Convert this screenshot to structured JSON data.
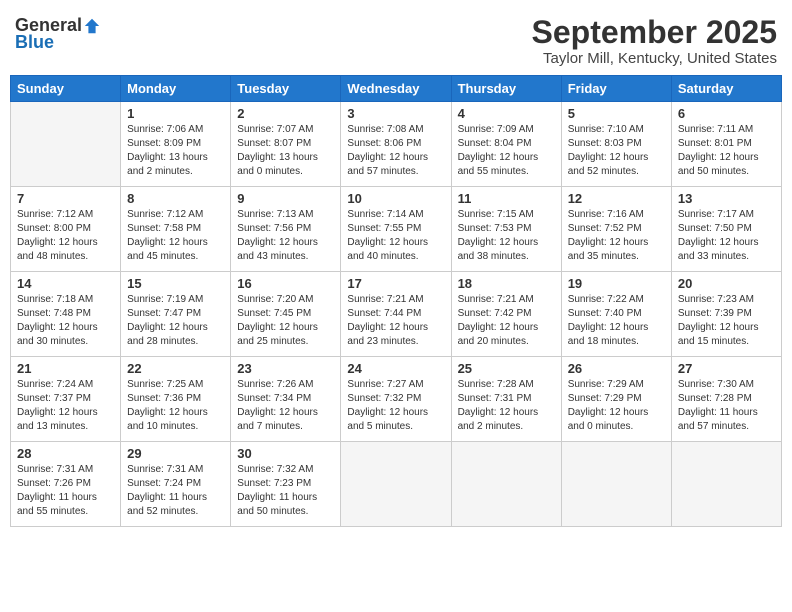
{
  "header": {
    "logo_general": "General",
    "logo_blue": "Blue",
    "month": "September 2025",
    "location": "Taylor Mill, Kentucky, United States"
  },
  "days_of_week": [
    "Sunday",
    "Monday",
    "Tuesday",
    "Wednesday",
    "Thursday",
    "Friday",
    "Saturday"
  ],
  "weeks": [
    [
      {
        "day": "",
        "sunrise": "",
        "sunset": "",
        "daylight": "",
        "empty": true
      },
      {
        "day": "1",
        "sunrise": "Sunrise: 7:06 AM",
        "sunset": "Sunset: 8:09 PM",
        "daylight": "Daylight: 13 hours and 2 minutes."
      },
      {
        "day": "2",
        "sunrise": "Sunrise: 7:07 AM",
        "sunset": "Sunset: 8:07 PM",
        "daylight": "Daylight: 13 hours and 0 minutes."
      },
      {
        "day": "3",
        "sunrise": "Sunrise: 7:08 AM",
        "sunset": "Sunset: 8:06 PM",
        "daylight": "Daylight: 12 hours and 57 minutes."
      },
      {
        "day": "4",
        "sunrise": "Sunrise: 7:09 AM",
        "sunset": "Sunset: 8:04 PM",
        "daylight": "Daylight: 12 hours and 55 minutes."
      },
      {
        "day": "5",
        "sunrise": "Sunrise: 7:10 AM",
        "sunset": "Sunset: 8:03 PM",
        "daylight": "Daylight: 12 hours and 52 minutes."
      },
      {
        "day": "6",
        "sunrise": "Sunrise: 7:11 AM",
        "sunset": "Sunset: 8:01 PM",
        "daylight": "Daylight: 12 hours and 50 minutes."
      }
    ],
    [
      {
        "day": "7",
        "sunrise": "Sunrise: 7:12 AM",
        "sunset": "Sunset: 8:00 PM",
        "daylight": "Daylight: 12 hours and 48 minutes."
      },
      {
        "day": "8",
        "sunrise": "Sunrise: 7:12 AM",
        "sunset": "Sunset: 7:58 PM",
        "daylight": "Daylight: 12 hours and 45 minutes."
      },
      {
        "day": "9",
        "sunrise": "Sunrise: 7:13 AM",
        "sunset": "Sunset: 7:56 PM",
        "daylight": "Daylight: 12 hours and 43 minutes."
      },
      {
        "day": "10",
        "sunrise": "Sunrise: 7:14 AM",
        "sunset": "Sunset: 7:55 PM",
        "daylight": "Daylight: 12 hours and 40 minutes."
      },
      {
        "day": "11",
        "sunrise": "Sunrise: 7:15 AM",
        "sunset": "Sunset: 7:53 PM",
        "daylight": "Daylight: 12 hours and 38 minutes."
      },
      {
        "day": "12",
        "sunrise": "Sunrise: 7:16 AM",
        "sunset": "Sunset: 7:52 PM",
        "daylight": "Daylight: 12 hours and 35 minutes."
      },
      {
        "day": "13",
        "sunrise": "Sunrise: 7:17 AM",
        "sunset": "Sunset: 7:50 PM",
        "daylight": "Daylight: 12 hours and 33 minutes."
      }
    ],
    [
      {
        "day": "14",
        "sunrise": "Sunrise: 7:18 AM",
        "sunset": "Sunset: 7:48 PM",
        "daylight": "Daylight: 12 hours and 30 minutes."
      },
      {
        "day": "15",
        "sunrise": "Sunrise: 7:19 AM",
        "sunset": "Sunset: 7:47 PM",
        "daylight": "Daylight: 12 hours and 28 minutes."
      },
      {
        "day": "16",
        "sunrise": "Sunrise: 7:20 AM",
        "sunset": "Sunset: 7:45 PM",
        "daylight": "Daylight: 12 hours and 25 minutes."
      },
      {
        "day": "17",
        "sunrise": "Sunrise: 7:21 AM",
        "sunset": "Sunset: 7:44 PM",
        "daylight": "Daylight: 12 hours and 23 minutes."
      },
      {
        "day": "18",
        "sunrise": "Sunrise: 7:21 AM",
        "sunset": "Sunset: 7:42 PM",
        "daylight": "Daylight: 12 hours and 20 minutes."
      },
      {
        "day": "19",
        "sunrise": "Sunrise: 7:22 AM",
        "sunset": "Sunset: 7:40 PM",
        "daylight": "Daylight: 12 hours and 18 minutes."
      },
      {
        "day": "20",
        "sunrise": "Sunrise: 7:23 AM",
        "sunset": "Sunset: 7:39 PM",
        "daylight": "Daylight: 12 hours and 15 minutes."
      }
    ],
    [
      {
        "day": "21",
        "sunrise": "Sunrise: 7:24 AM",
        "sunset": "Sunset: 7:37 PM",
        "daylight": "Daylight: 12 hours and 13 minutes."
      },
      {
        "day": "22",
        "sunrise": "Sunrise: 7:25 AM",
        "sunset": "Sunset: 7:36 PM",
        "daylight": "Daylight: 12 hours and 10 minutes."
      },
      {
        "day": "23",
        "sunrise": "Sunrise: 7:26 AM",
        "sunset": "Sunset: 7:34 PM",
        "daylight": "Daylight: 12 hours and 7 minutes."
      },
      {
        "day": "24",
        "sunrise": "Sunrise: 7:27 AM",
        "sunset": "Sunset: 7:32 PM",
        "daylight": "Daylight: 12 hours and 5 minutes."
      },
      {
        "day": "25",
        "sunrise": "Sunrise: 7:28 AM",
        "sunset": "Sunset: 7:31 PM",
        "daylight": "Daylight: 12 hours and 2 minutes."
      },
      {
        "day": "26",
        "sunrise": "Sunrise: 7:29 AM",
        "sunset": "Sunset: 7:29 PM",
        "daylight": "Daylight: 12 hours and 0 minutes."
      },
      {
        "day": "27",
        "sunrise": "Sunrise: 7:30 AM",
        "sunset": "Sunset: 7:28 PM",
        "daylight": "Daylight: 11 hours and 57 minutes."
      }
    ],
    [
      {
        "day": "28",
        "sunrise": "Sunrise: 7:31 AM",
        "sunset": "Sunset: 7:26 PM",
        "daylight": "Daylight: 11 hours and 55 minutes."
      },
      {
        "day": "29",
        "sunrise": "Sunrise: 7:31 AM",
        "sunset": "Sunset: 7:24 PM",
        "daylight": "Daylight: 11 hours and 52 minutes."
      },
      {
        "day": "30",
        "sunrise": "Sunrise: 7:32 AM",
        "sunset": "Sunset: 7:23 PM",
        "daylight": "Daylight: 11 hours and 50 minutes."
      },
      {
        "day": "",
        "sunrise": "",
        "sunset": "",
        "daylight": "",
        "empty": true
      },
      {
        "day": "",
        "sunrise": "",
        "sunset": "",
        "daylight": "",
        "empty": true
      },
      {
        "day": "",
        "sunrise": "",
        "sunset": "",
        "daylight": "",
        "empty": true
      },
      {
        "day": "",
        "sunrise": "",
        "sunset": "",
        "daylight": "",
        "empty": true
      }
    ]
  ]
}
